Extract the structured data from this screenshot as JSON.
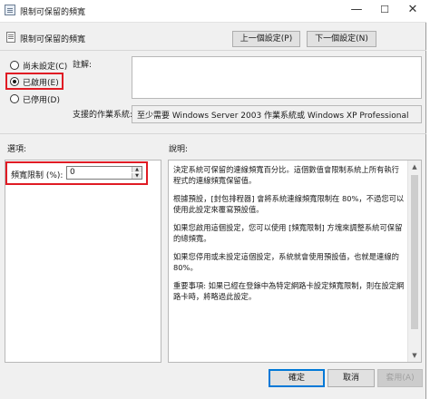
{
  "window": {
    "title": "限制可保留的頻寬",
    "controls": {
      "minimize": "—",
      "maximize": "☐",
      "close": "✕"
    }
  },
  "header": {
    "policy_name": "限制可保留的頻寬",
    "prev_button": "上一個設定(P)",
    "next_button": "下一個設定(N)"
  },
  "state_radios": [
    {
      "label": "尚未設定(C)",
      "selected": false
    },
    {
      "label": "已啟用(E)",
      "selected": true
    },
    {
      "label": "已停用(D)",
      "selected": false
    }
  ],
  "comment": {
    "label": "註解:",
    "value": ""
  },
  "supported": {
    "label": "支援的作業系統:",
    "value": "至少需要 Windows Server 2003 作業系統或 Windows XP Professional"
  },
  "options": {
    "section_label": "選項:",
    "field_label": "頻寬限制 (%):",
    "field_value": "0"
  },
  "help": {
    "section_label": "說明:",
    "paragraphs": [
      "決定系統可保留的連線頻寬百分比。這個數值會限制系統上所有執行程式的連線頻寬保留值。",
      "根據預設，[封包排程器] 會將系統連線頻寬限制在 80%，不過您可以使用此設定來覆寫預設值。",
      "如果您啟用這個設定，您可以使用 [頻寬限制] 方塊來調整系統可保留的總頻寬。",
      "如果您停用或未設定這個設定，系統就會使用預設值，也就是連線的 80%。",
      "重要事項: 如果已經在登錄中為特定網路卡設定頻寬限制，則在設定網路卡時，將略過此設定。"
    ]
  },
  "footer": {
    "ok": "確定",
    "cancel": "取消",
    "apply": "套用(A)"
  }
}
